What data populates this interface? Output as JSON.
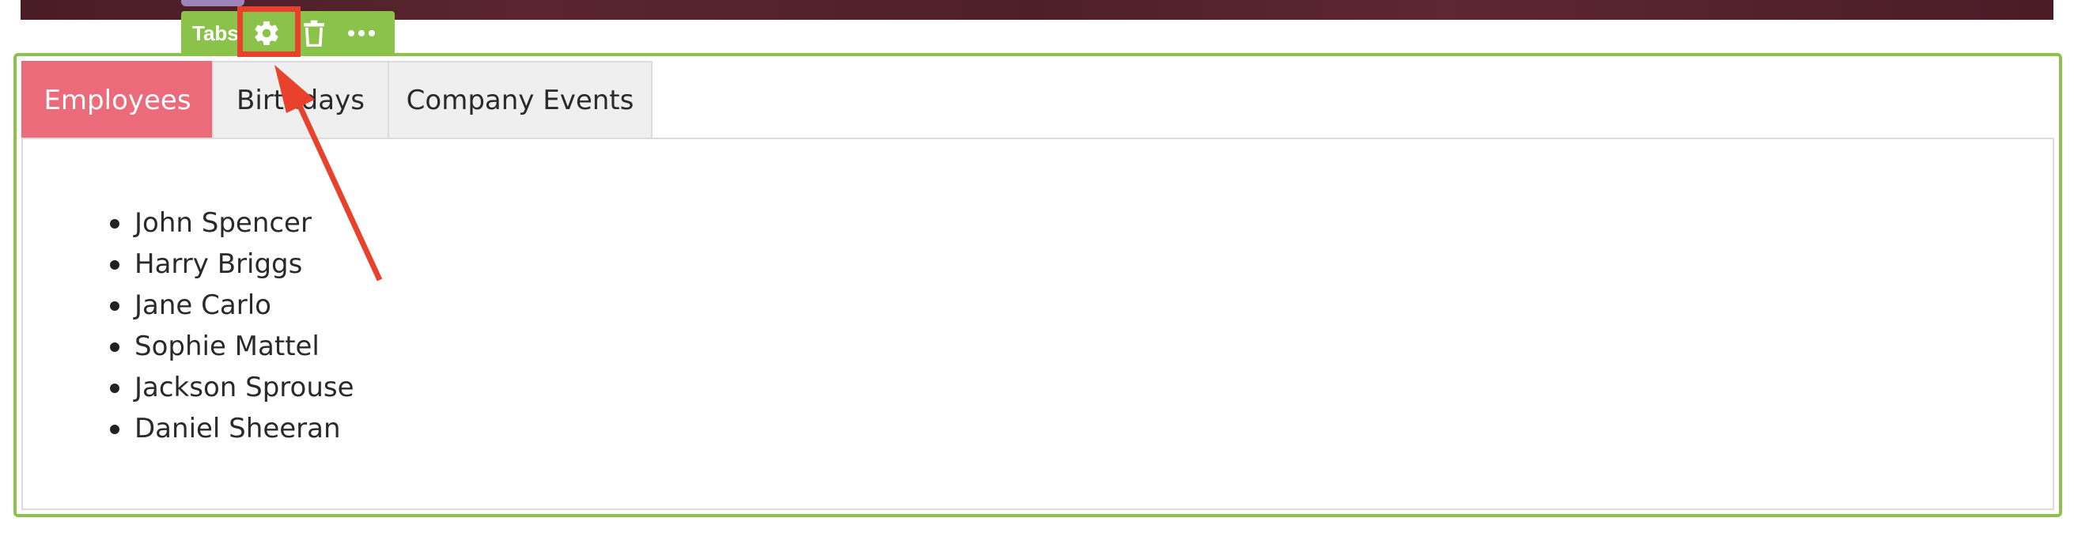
{
  "module": {
    "name": "Tabs",
    "actions": [
      {
        "icon": "gear-icon",
        "label": "settings"
      },
      {
        "icon": "trash-icon",
        "label": "delete"
      },
      {
        "icon": "more-icon",
        "label": "more"
      }
    ]
  },
  "tabs": [
    {
      "label": "Employees",
      "active": true
    },
    {
      "label": "Birthdays",
      "active": false
    },
    {
      "label": "Company Events",
      "active": false
    }
  ],
  "employees": [
    "John Spencer",
    "Harry Briggs",
    "Jane Carlo",
    "Sophie Mattel",
    "Jackson Sprouse",
    "Daniel Sheeran"
  ],
  "colors": {
    "toolbar": "#8bc34a",
    "active_tab": "#ec6b7a",
    "annotation": "#e8412c",
    "banner": "#4f1f29"
  }
}
